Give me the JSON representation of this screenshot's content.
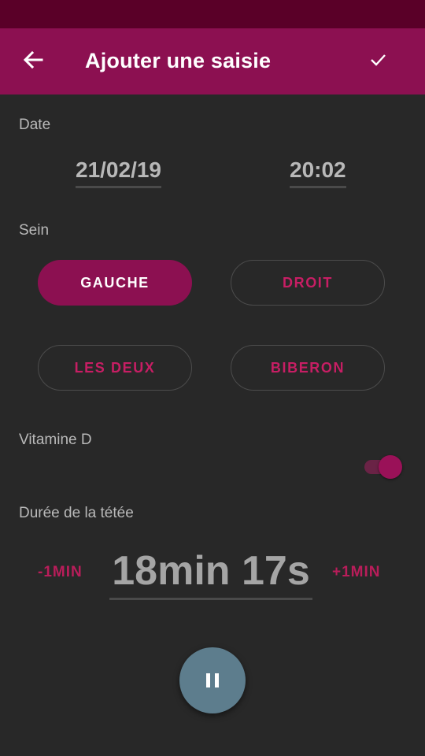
{
  "app_bar": {
    "title": "Ajouter une saisie",
    "back_icon": "arrow-back-icon",
    "confirm_icon": "check-icon"
  },
  "date_section": {
    "label": "Date",
    "date_value": "21/02/19",
    "time_value": "20:02"
  },
  "sein_section": {
    "label": "Sein",
    "options": [
      {
        "label": "GAUCHE",
        "selected": true
      },
      {
        "label": "DROIT",
        "selected": false
      },
      {
        "label": "LES DEUX",
        "selected": false
      },
      {
        "label": "BIBERON",
        "selected": false
      }
    ]
  },
  "vitamine_section": {
    "label": "Vitamine D",
    "toggle_on": true
  },
  "duration_section": {
    "label": "Durée de la tétée",
    "minus_label": "-1MIN",
    "plus_label": "+1MIN",
    "timer_value": "18min 17s"
  },
  "fab": {
    "icon": "pause-icon"
  },
  "colors": {
    "primary": "#8c1051",
    "primary_dark": "#5a0028",
    "accent_text": "#c71e64",
    "background": "#282828",
    "fab": "#5d7d8d"
  }
}
